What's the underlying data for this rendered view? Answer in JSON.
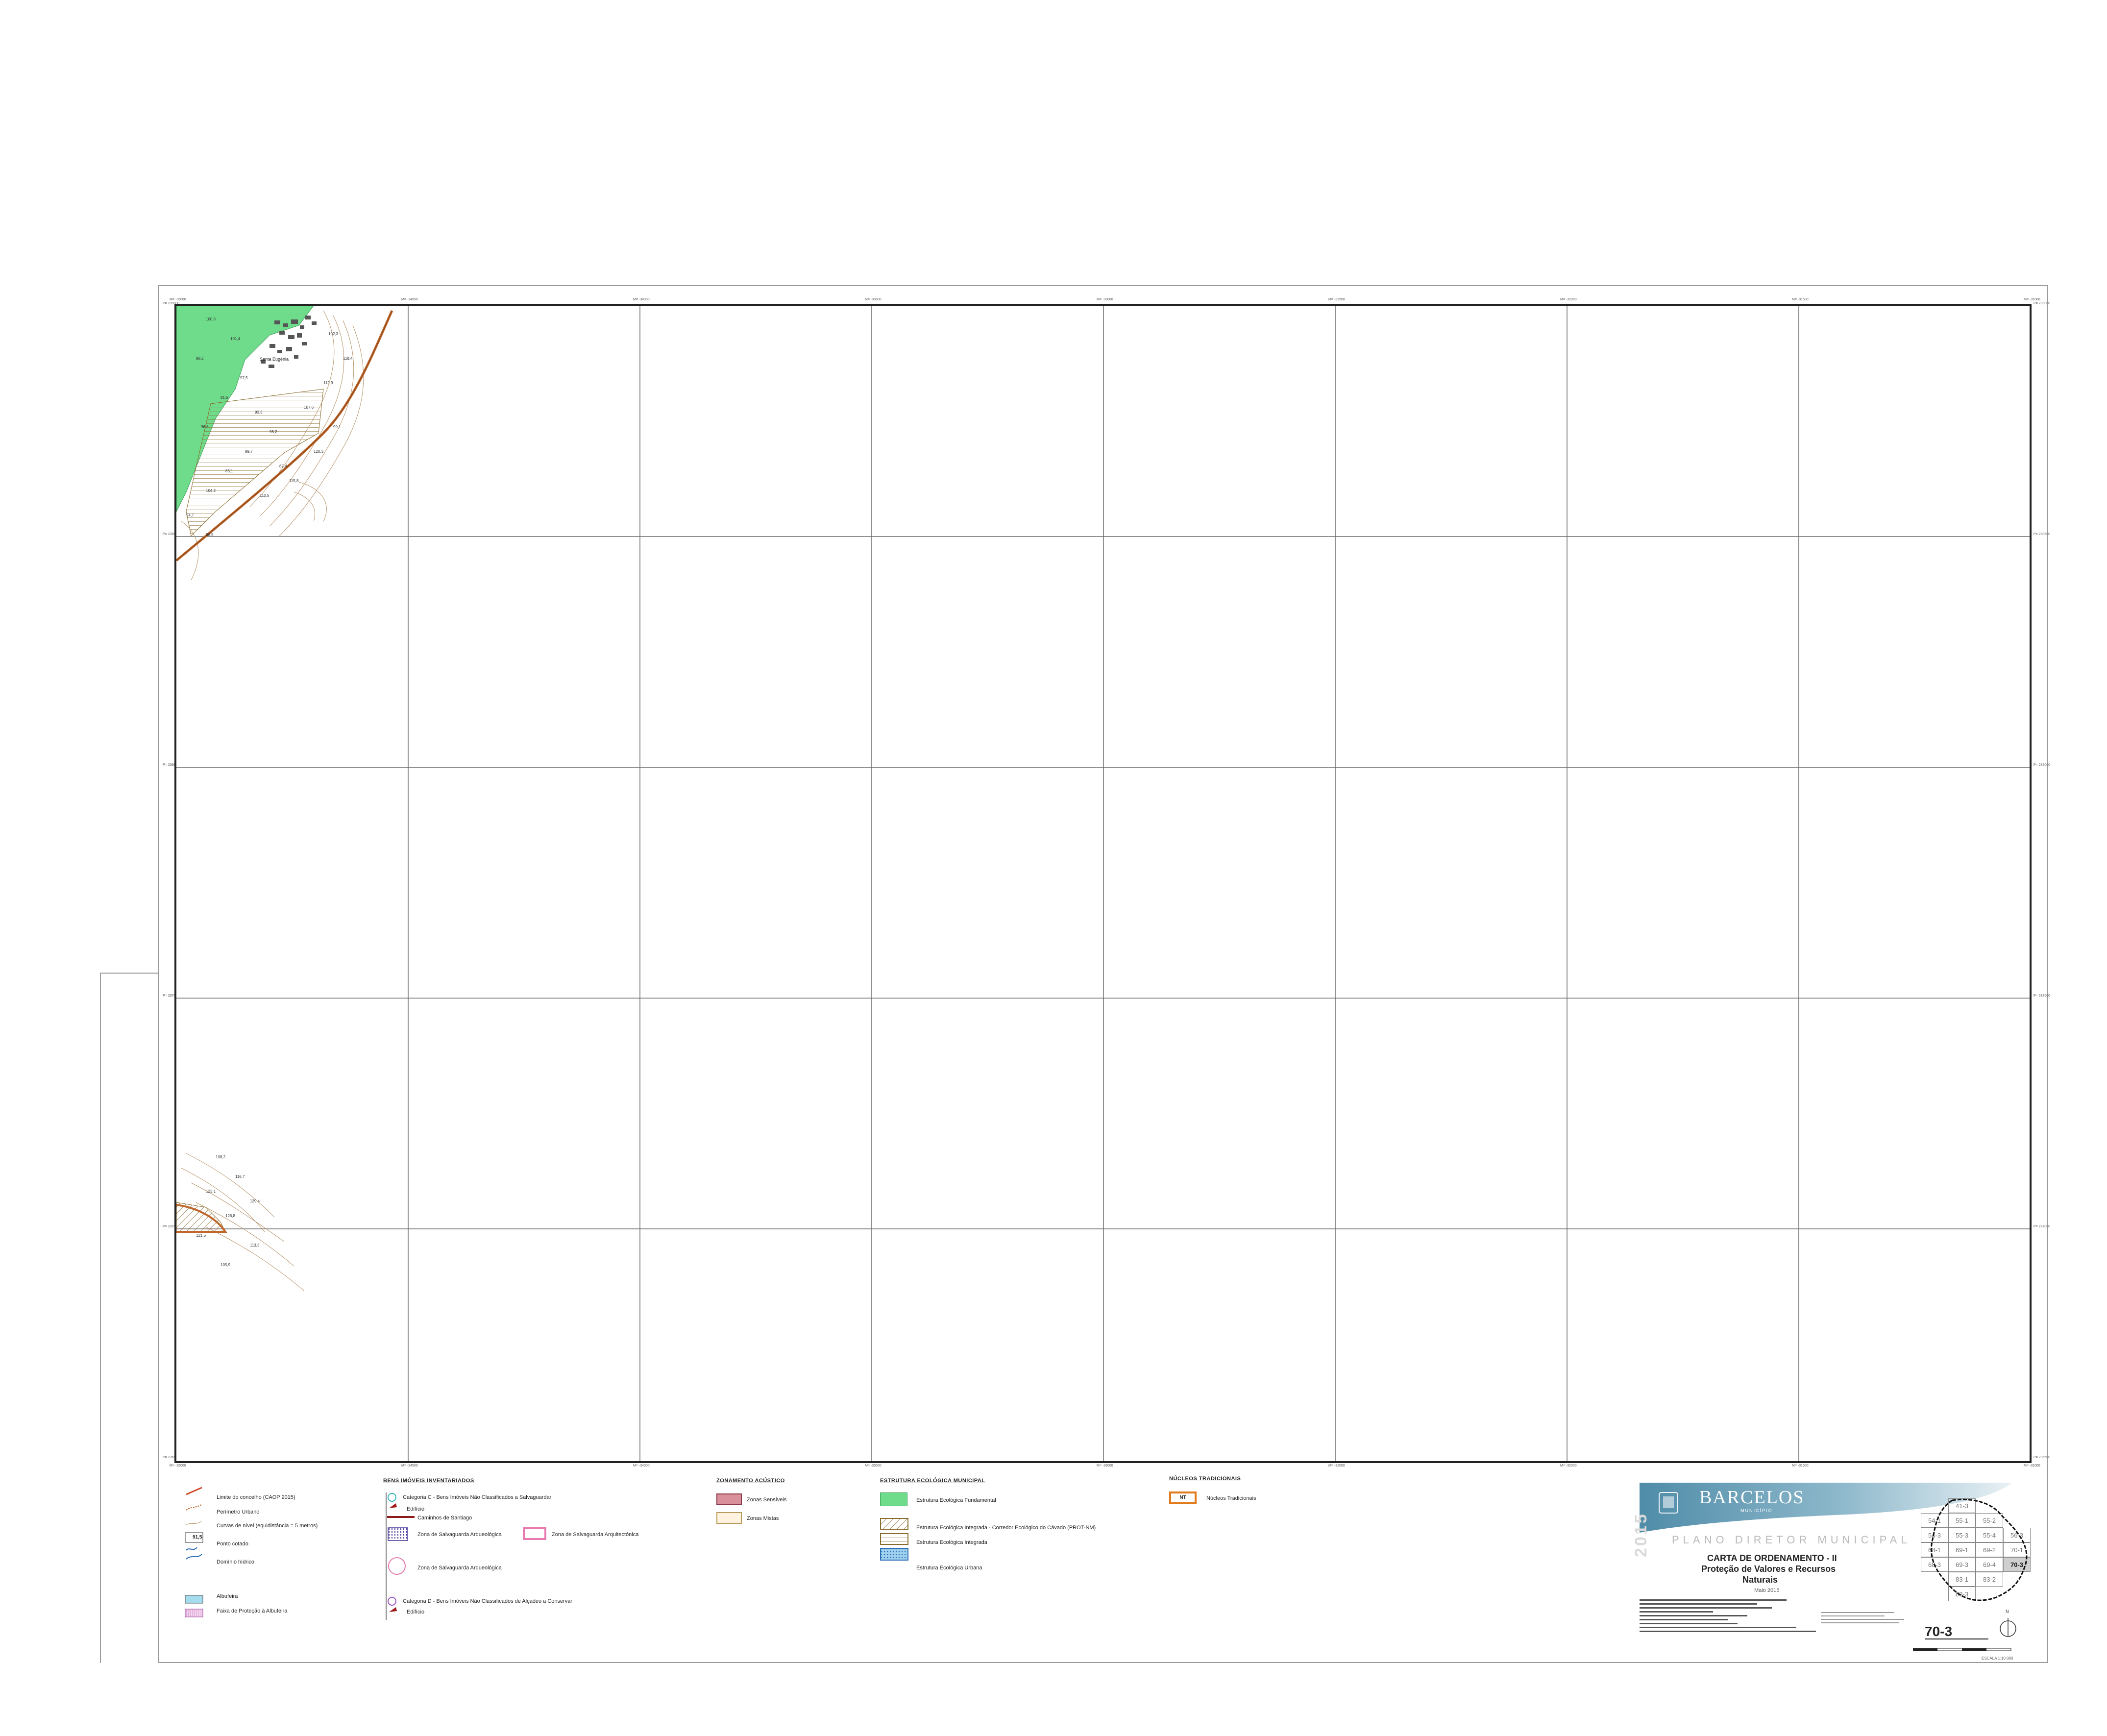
{
  "map": {
    "coord_labels": {
      "top": [
        "M= -35000",
        "M= -34500",
        "M= -34000",
        "M= -33500",
        "M= -33000",
        "M= -32500",
        "M= -32000",
        "M= -31500",
        "M= -31000"
      ],
      "right": [
        "P= 239000",
        "P= 238500",
        "P= 238000",
        "P= 237500",
        "P= 237000",
        "P= 236500"
      ]
    },
    "elevation_labels": [
      "100,6",
      "101,4",
      "98,2",
      "97,5",
      "91,5",
      "93,3",
      "96,8",
      "95,2",
      "89,7",
      "87,4",
      "85,1",
      "104,2",
      "110,5",
      "115,8",
      "120,3",
      "99,1",
      "107,6",
      "112,9",
      "118,4",
      "102,3",
      "94,7",
      "86,5",
      "108,2",
      "116,7",
      "123,1",
      "129,4",
      "126,8",
      "121,5",
      "113,3",
      "105,9"
    ],
    "places": [
      "Santa Eugénia"
    ]
  },
  "legend": {
    "col1": {
      "items": [
        {
          "label": "Limite do concelho (CAOP 2015)"
        },
        {
          "label": "Perímetro Urbano"
        },
        {
          "label": "Curvas de nível (equidistância = 5 metros)"
        },
        {
          "label": "Ponto cotado",
          "sample": "91,5"
        },
        {
          "label": "Domínio hídrico"
        },
        {
          "label": "Albufeira"
        },
        {
          "label": "Faixa de Proteção à Albufeira"
        }
      ]
    },
    "col2": {
      "heading": "BENS IMÓVEIS INVENTARIADOS",
      "cat_c": "Categoria C - Bens Imóveis Não Classificados a Salvaguardar",
      "edificio": "Edifício",
      "caminhos": "Caminhos de Santiago",
      "zona_arq": "Zona de Salvaguarda Arqueológica",
      "zona_arquitet": "Zona de Salvaguarda Arquitectónica",
      "zona_arq2": "Zona de Salvaguarda Arqueológica",
      "cat_d": "Categoria D - Bens Imóveis Não Classificados de Alçadeu a Conservar",
      "edificio2": "Edifício"
    },
    "col3": {
      "heading": "ZONAMENTO ACÚSTICO",
      "items": [
        {
          "label": "Zonas Sensíveis",
          "color": "#d9909a"
        },
        {
          "label": "Zonas Mistas",
          "color": "#fff3df"
        }
      ]
    },
    "col4": {
      "heading": "ESTRUTURA ECOLÓGICA MUNICIPAL",
      "items": [
        {
          "label": "Estrutura Ecológica Fundamental",
          "color": "#6fdc8c"
        },
        {
          "label": "Estrutura Ecológica Integrada - Corredor Ecológico do Cávado (PROT-NM)"
        },
        {
          "label": "Estrutura Ecológica Integrada"
        },
        {
          "label": "Estrutura Ecológica Urbana"
        }
      ]
    },
    "col5": {
      "heading": "NÚCLEOS TRADICIONAIS",
      "sample": "NT",
      "label": "Núcleos Tradicionais"
    }
  },
  "title_block": {
    "brand": "BARCELOS",
    "brand_sub": "MUNICÍPIO",
    "plan": "PLANO DIRETOR MUNICIPAL",
    "year": "2015",
    "title1": "CARTA DE ORDENAMENTO - II",
    "title2": "Proteção de Valores e Recursos",
    "title3": "Naturais",
    "date": "Maio 2015",
    "sheet": "70-3",
    "scale": "ESCALA 1:10 000",
    "north": "N",
    "index_cells": [
      "41-3",
      "54-1",
      "55-1",
      "55-2",
      "54-3",
      "55-3",
      "55-4",
      "56-3",
      "68-1",
      "69-1",
      "69-2",
      "70-1",
      "68-3",
      "69-3",
      "69-4",
      "70-3",
      "83-1",
      "83-2",
      "83-3"
    ]
  }
}
